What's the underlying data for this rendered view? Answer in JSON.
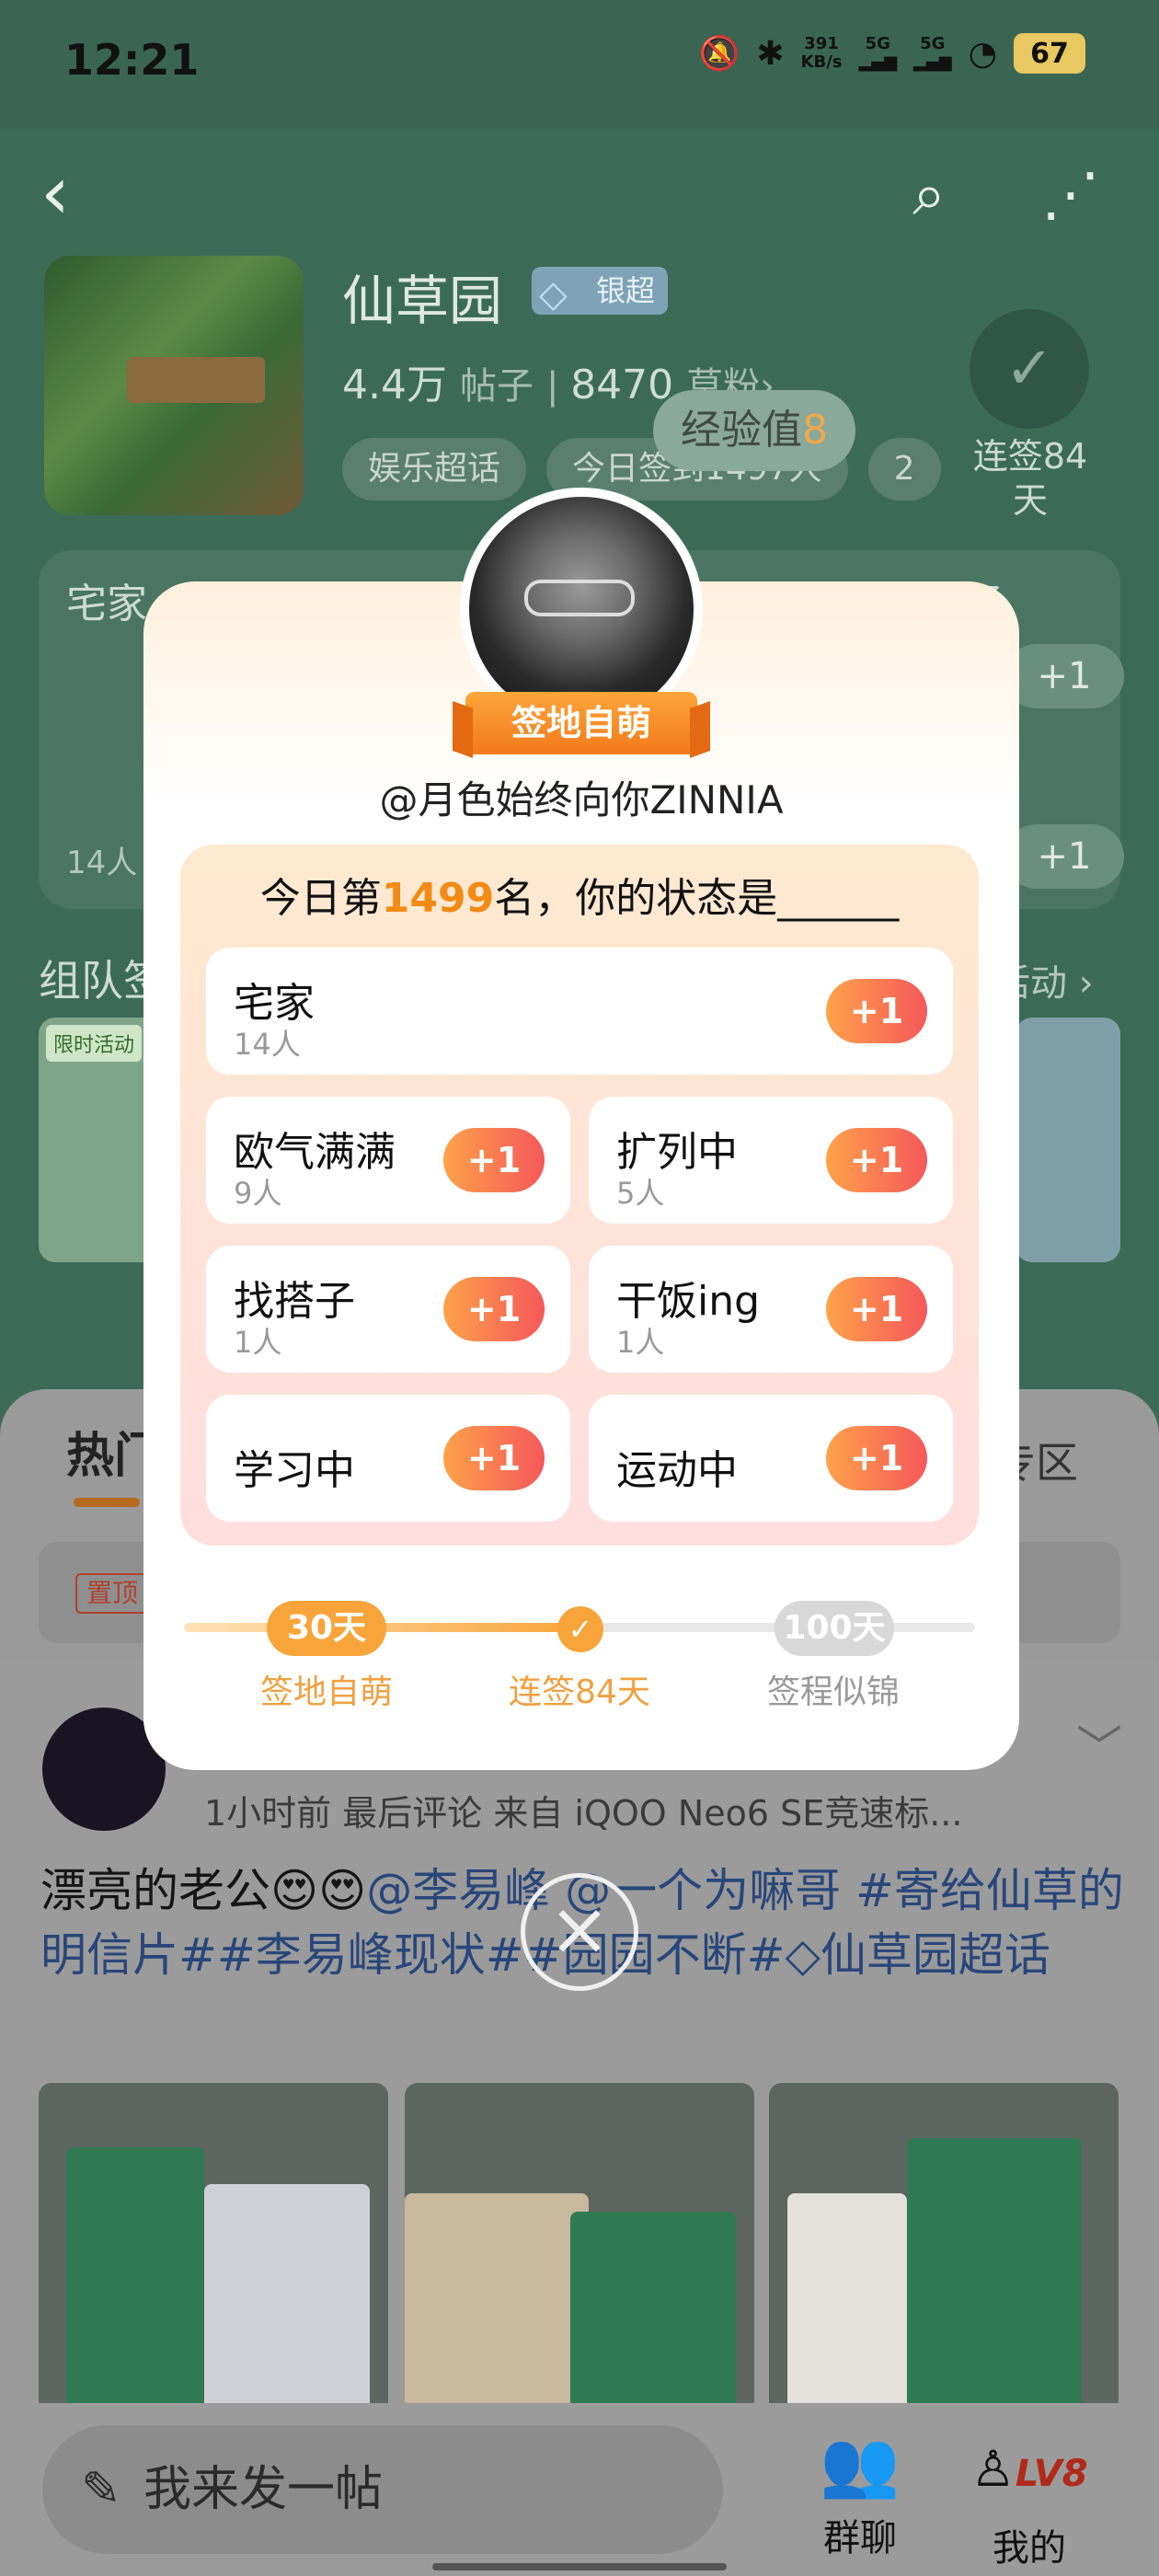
{
  "status_bar": {
    "time": "12:21",
    "net_speed_top": "391",
    "net_speed_unit": "KB/s",
    "sig1": "5G",
    "sig2": "5G",
    "battery": "67"
  },
  "header": {
    "title": "仙草园",
    "badge": "银超",
    "posts_count": "4.4万",
    "posts_label": "帖子",
    "fans_count": "8470",
    "fans_label": "草粉",
    "tags": [
      "娱乐超话",
      "今日签到1497人",
      "2"
    ],
    "exp_label": "经验值",
    "exp_value": "8",
    "streak_label": "连签84天"
  },
  "status_preview": {
    "left_title": "宅家",
    "left_count": "14人",
    "right_title": "找搭子",
    "plus": "+1"
  },
  "team": {
    "title": "组队签",
    "more": "活动"
  },
  "banner_tag": "限时活动",
  "feed": {
    "tab_hot": "热门",
    "zone_label": "专区",
    "pin_label": "置顶",
    "meta": "1小时前 最后评论   来自 iQOO Neo6 SE竞速标...",
    "text_plain": "漂亮的老公😍😍",
    "text_links": "@李易峰 @一个为嘛哥 #寄给仙草的明信片##李易峰现状##园园不断#",
    "text_tail": "仙草园超话"
  },
  "bottom_bar": {
    "compose": "我来发一帖",
    "group_chat": "群聊",
    "mine": "我的",
    "level": "LV8"
  },
  "modal": {
    "avatar_ribbon": "签地自萌",
    "username": "@月色始终向你ZINNIA",
    "rank_prefix": "今日第",
    "rank_num": "1499",
    "rank_suffix": "名，你的状态是______",
    "options": [
      {
        "name": "宅家",
        "count": "14人"
      },
      {
        "name": "欧气满满",
        "count": "9人"
      },
      {
        "name": "扩列中",
        "count": "5人"
      },
      {
        "name": "找搭子",
        "count": "1人"
      },
      {
        "name": "干饭ing",
        "count": "1人"
      },
      {
        "name": "学习中",
        "count": ""
      },
      {
        "name": "运动中",
        "count": ""
      }
    ],
    "plus_label": "+1",
    "progress": {
      "m1_days": "30天",
      "m1_label": "签地自萌",
      "m2_label": "连签84天",
      "m3_days": "100天",
      "m3_label": "签程似锦",
      "current_days": 84
    },
    "close_icon": "close-icon"
  },
  "colors": {
    "accent_orange": "#f28a14",
    "overlay_green": "#3b6b57",
    "plus_gradient_start": "#ffa24a",
    "plus_gradient_end": "#f5585a"
  }
}
